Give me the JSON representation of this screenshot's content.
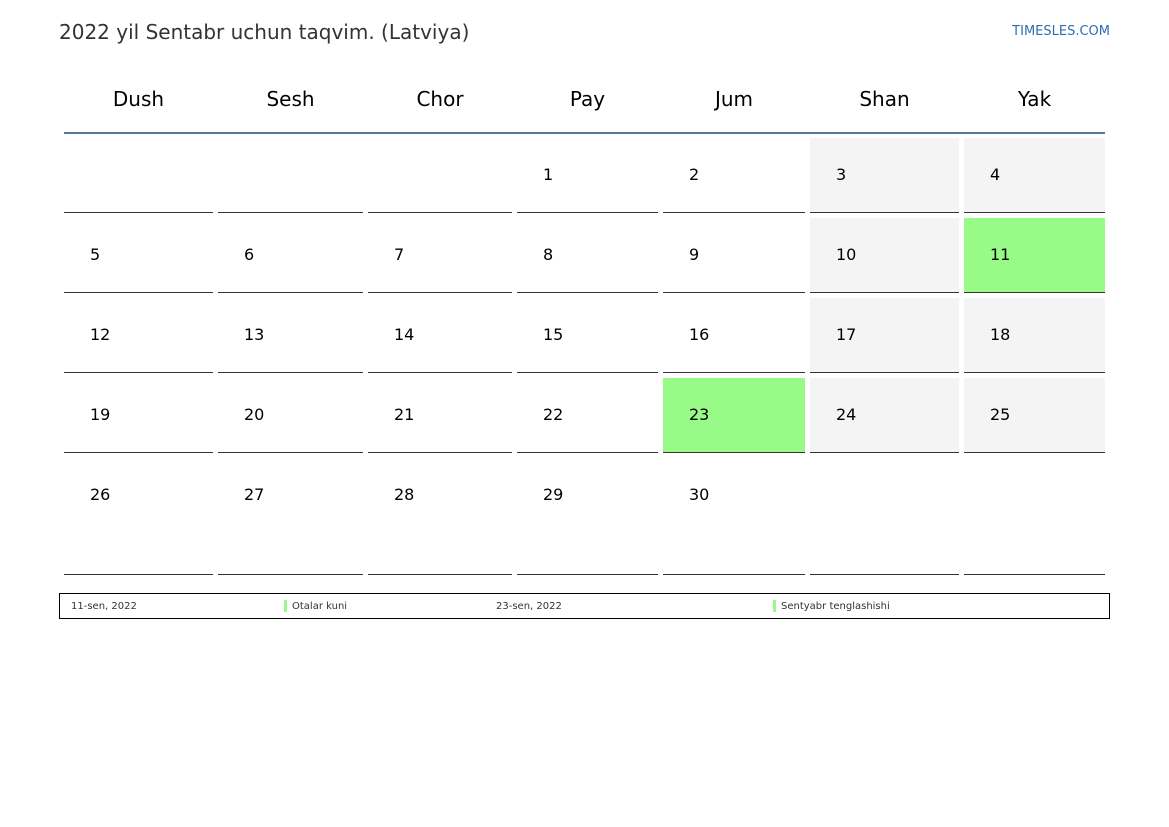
{
  "header": {
    "title": "2022 yil Sentabr uchun taqvim. (Latviya)",
    "brand": "TIMESLES.COM"
  },
  "colors": {
    "holiday": "#98fb88",
    "weekend": "#f4f4f4",
    "header_rule": "#5a7698",
    "brand": "#2f6fb0"
  },
  "weekdays": [
    "Dush",
    "Sesh",
    "Chor",
    "Pay",
    "Jum",
    "Shan",
    "Yak"
  ],
  "weeks": [
    [
      "",
      "",
      "",
      "1",
      "2",
      "3",
      "4"
    ],
    [
      "5",
      "6",
      "7",
      "8",
      "9",
      "10",
      "11"
    ],
    [
      "12",
      "13",
      "14",
      "15",
      "16",
      "17",
      "18"
    ],
    [
      "19",
      "20",
      "21",
      "22",
      "23",
      "24",
      "25"
    ],
    [
      "26",
      "27",
      "28",
      "29",
      "30",
      "",
      ""
    ]
  ],
  "holidays": [
    "11",
    "23"
  ],
  "legend": [
    {
      "date": "11-sen, 2022",
      "name": "Otalar kuni"
    },
    {
      "date": "23-sen, 2022",
      "name": "Sentyabr tenglashishi"
    }
  ]
}
